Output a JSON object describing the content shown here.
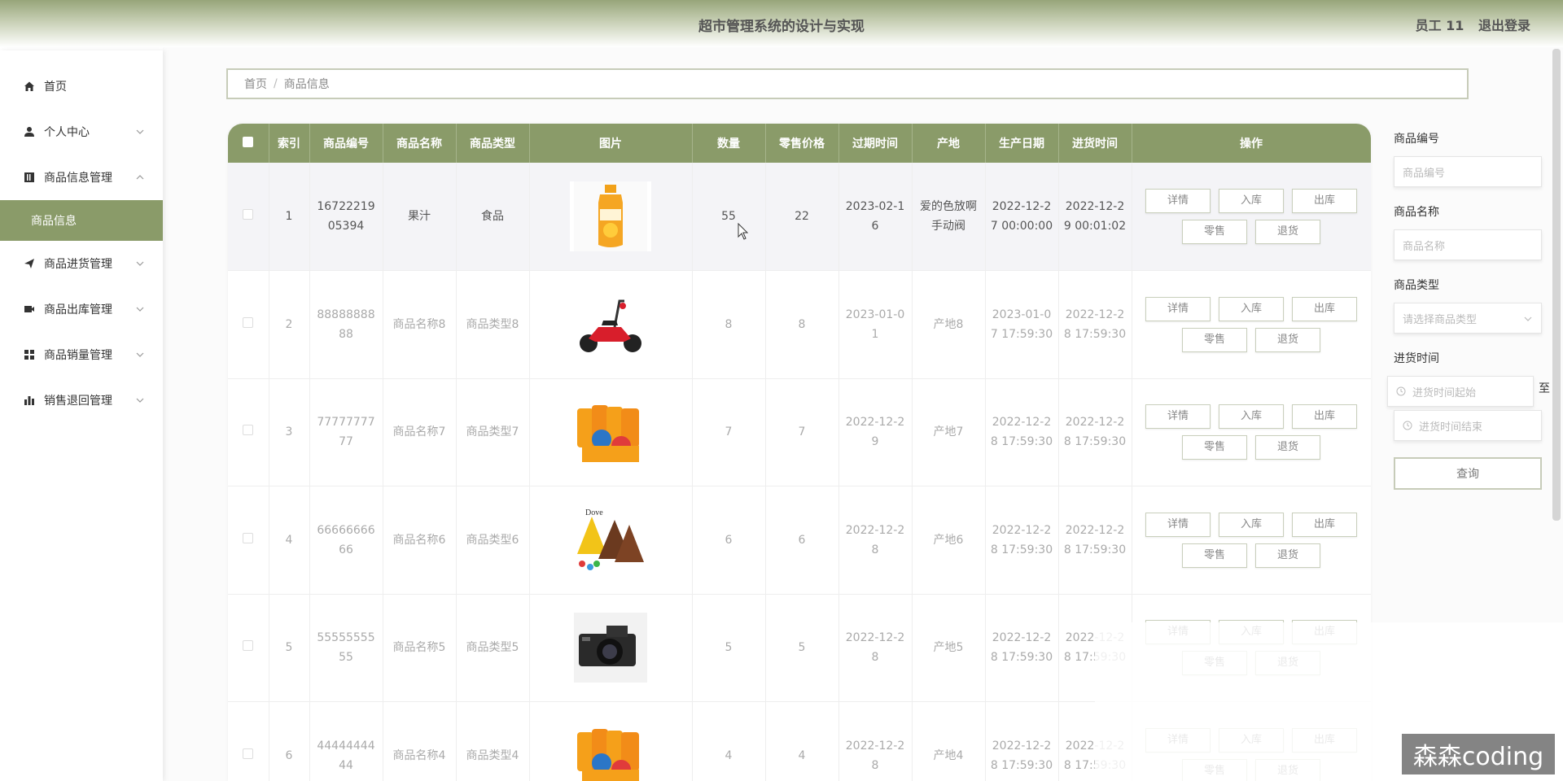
{
  "header": {
    "title": "超市管理系统的设计与实现",
    "user": "员工 11",
    "logout": "退出登录"
  },
  "sidebar": {
    "items": [
      {
        "label": "首页",
        "icon": "home-icon"
      },
      {
        "label": "个人中心",
        "icon": "user-icon"
      },
      {
        "label": "商品信息管理",
        "icon": "book-icon"
      },
      {
        "label": "商品信息",
        "icon": ""
      },
      {
        "label": "商品进货管理",
        "icon": "send-icon"
      },
      {
        "label": "商品出库管理",
        "icon": "camera-icon"
      },
      {
        "label": "商品销量管理",
        "icon": "grid-icon"
      },
      {
        "label": "销售退回管理",
        "icon": "chart-icon"
      }
    ]
  },
  "breadcrumb": {
    "home": "首页",
    "sep": "/",
    "current": "商品信息"
  },
  "table": {
    "headers": [
      "索引",
      "商品编号",
      "商品名称",
      "商品类型",
      "图片",
      "数量",
      "零售价格",
      "过期时间",
      "产地",
      "生产日期",
      "进货时间",
      "操作"
    ],
    "actions": {
      "detail": "详情",
      "in": "入库",
      "out": "出库",
      "retail": "零售",
      "return": "退货"
    },
    "rows": [
      {
        "index": "1",
        "code": "1672221905394",
        "name": "果汁",
        "type": "食品",
        "image": "juice-bottle",
        "qty": "55",
        "price": "22",
        "expire": "2023-02-16",
        "origin": "爱的色放啊手动阀",
        "produce": "2022-12-27 00:00:00",
        "stock_in": "2022-12-29 00:01:02"
      },
      {
        "index": "2",
        "code": "8888888888",
        "name": "商品名称8",
        "type": "商品类型8",
        "image": "scooter",
        "qty": "8",
        "price": "8",
        "expire": "2023-01-01",
        "origin": "产地8",
        "produce": "2023-01-07 17:59:30",
        "stock_in": "2022-12-28 17:59:30"
      },
      {
        "index": "3",
        "code": "7777777777",
        "name": "商品名称7",
        "type": "商品类型7",
        "image": "juice-pack",
        "qty": "7",
        "price": "7",
        "expire": "2022-12-29",
        "origin": "产地7",
        "produce": "2022-12-28 17:59:30",
        "stock_in": "2022-12-28 17:59:30"
      },
      {
        "index": "4",
        "code": "6666666666",
        "name": "商品名称6",
        "type": "商品类型6",
        "image": "chocolate",
        "qty": "6",
        "price": "6",
        "expire": "2022-12-28",
        "origin": "产地6",
        "produce": "2022-12-28 17:59:30",
        "stock_in": "2022-12-28 17:59:30"
      },
      {
        "index": "5",
        "code": "5555555555",
        "name": "商品名称5",
        "type": "商品类型5",
        "image": "camera",
        "qty": "5",
        "price": "5",
        "expire": "2022-12-28",
        "origin": "产地5",
        "produce": "2022-12-28 17:59:30",
        "stock_in": "2022-12-28 17:59:30"
      },
      {
        "index": "6",
        "code": "4444444444",
        "name": "商品名称4",
        "type": "商品类型4",
        "image": "juice-pack",
        "qty": "4",
        "price": "4",
        "expire": "2022-12-28",
        "origin": "产地4",
        "produce": "2022-12-28 17:59:30",
        "stock_in": "2022-12-28 17:59:30"
      }
    ]
  },
  "search": {
    "code_label": "商品编号",
    "code_placeholder": "商品编号",
    "name_label": "商品名称",
    "name_placeholder": "商品名称",
    "type_label": "商品类型",
    "type_placeholder": "请选择商品类型",
    "time_label": "进货时间",
    "time_start_placeholder": "进货时间起始",
    "time_end_placeholder": "进货时间结束",
    "to": "至",
    "query": "查询"
  },
  "watermark": "森森coding",
  "colors": {
    "accent": "#8a9b69",
    "header": "#97a57a"
  }
}
